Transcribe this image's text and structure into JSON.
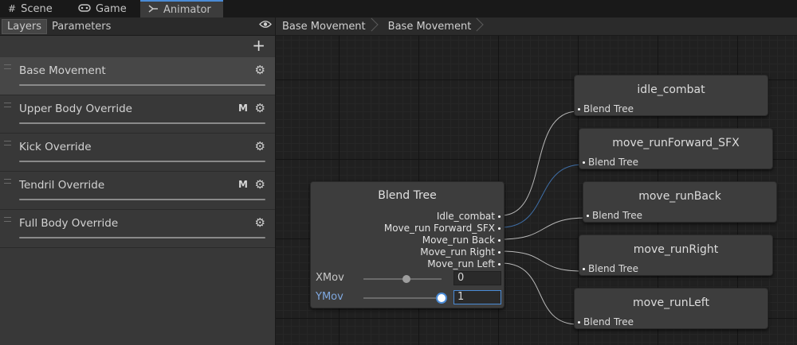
{
  "tabs": [
    {
      "label": "Scene",
      "icon": "grid-icon"
    },
    {
      "label": "Game",
      "icon": "gamepad-icon"
    },
    {
      "label": "Animator",
      "icon": "animator-icon"
    }
  ],
  "left_panel": {
    "subtabs": [
      "Layers",
      "Parameters"
    ],
    "layers": [
      {
        "name": "Base Movement",
        "mask": ""
      },
      {
        "name": "Upper Body Override",
        "mask": "M"
      },
      {
        "name": "Kick Override",
        "mask": ""
      },
      {
        "name": "Tendril Override",
        "mask": "M"
      },
      {
        "name": "Full Body Override",
        "mask": ""
      }
    ]
  },
  "breadcrumb": [
    "Base Movement",
    "Base Movement"
  ],
  "blend_tree": {
    "title": "Blend Tree",
    "outputs": [
      "Idle_combat",
      "Move_run Forward_SFX",
      "Move_run Back",
      "Move_run Right",
      "Move_run Left"
    ],
    "params": [
      {
        "name": "XMov",
        "value": "0"
      },
      {
        "name": "YMov",
        "value": "1"
      }
    ]
  },
  "motion_nodes": [
    {
      "title": "idle_combat",
      "port": "Blend Tree"
    },
    {
      "title": "move_runForward_SFX",
      "port": "Blend Tree"
    },
    {
      "title": "move_runBack",
      "port": "Blend Tree"
    },
    {
      "title": "move_runRight",
      "port": "Blend Tree"
    },
    {
      "title": "move_runLeft",
      "port": "Blend Tree"
    }
  ],
  "colors": {
    "accent": "#4a8bd6",
    "wire": "#b8b8b8",
    "wire_selected": "#3f6fa8"
  }
}
